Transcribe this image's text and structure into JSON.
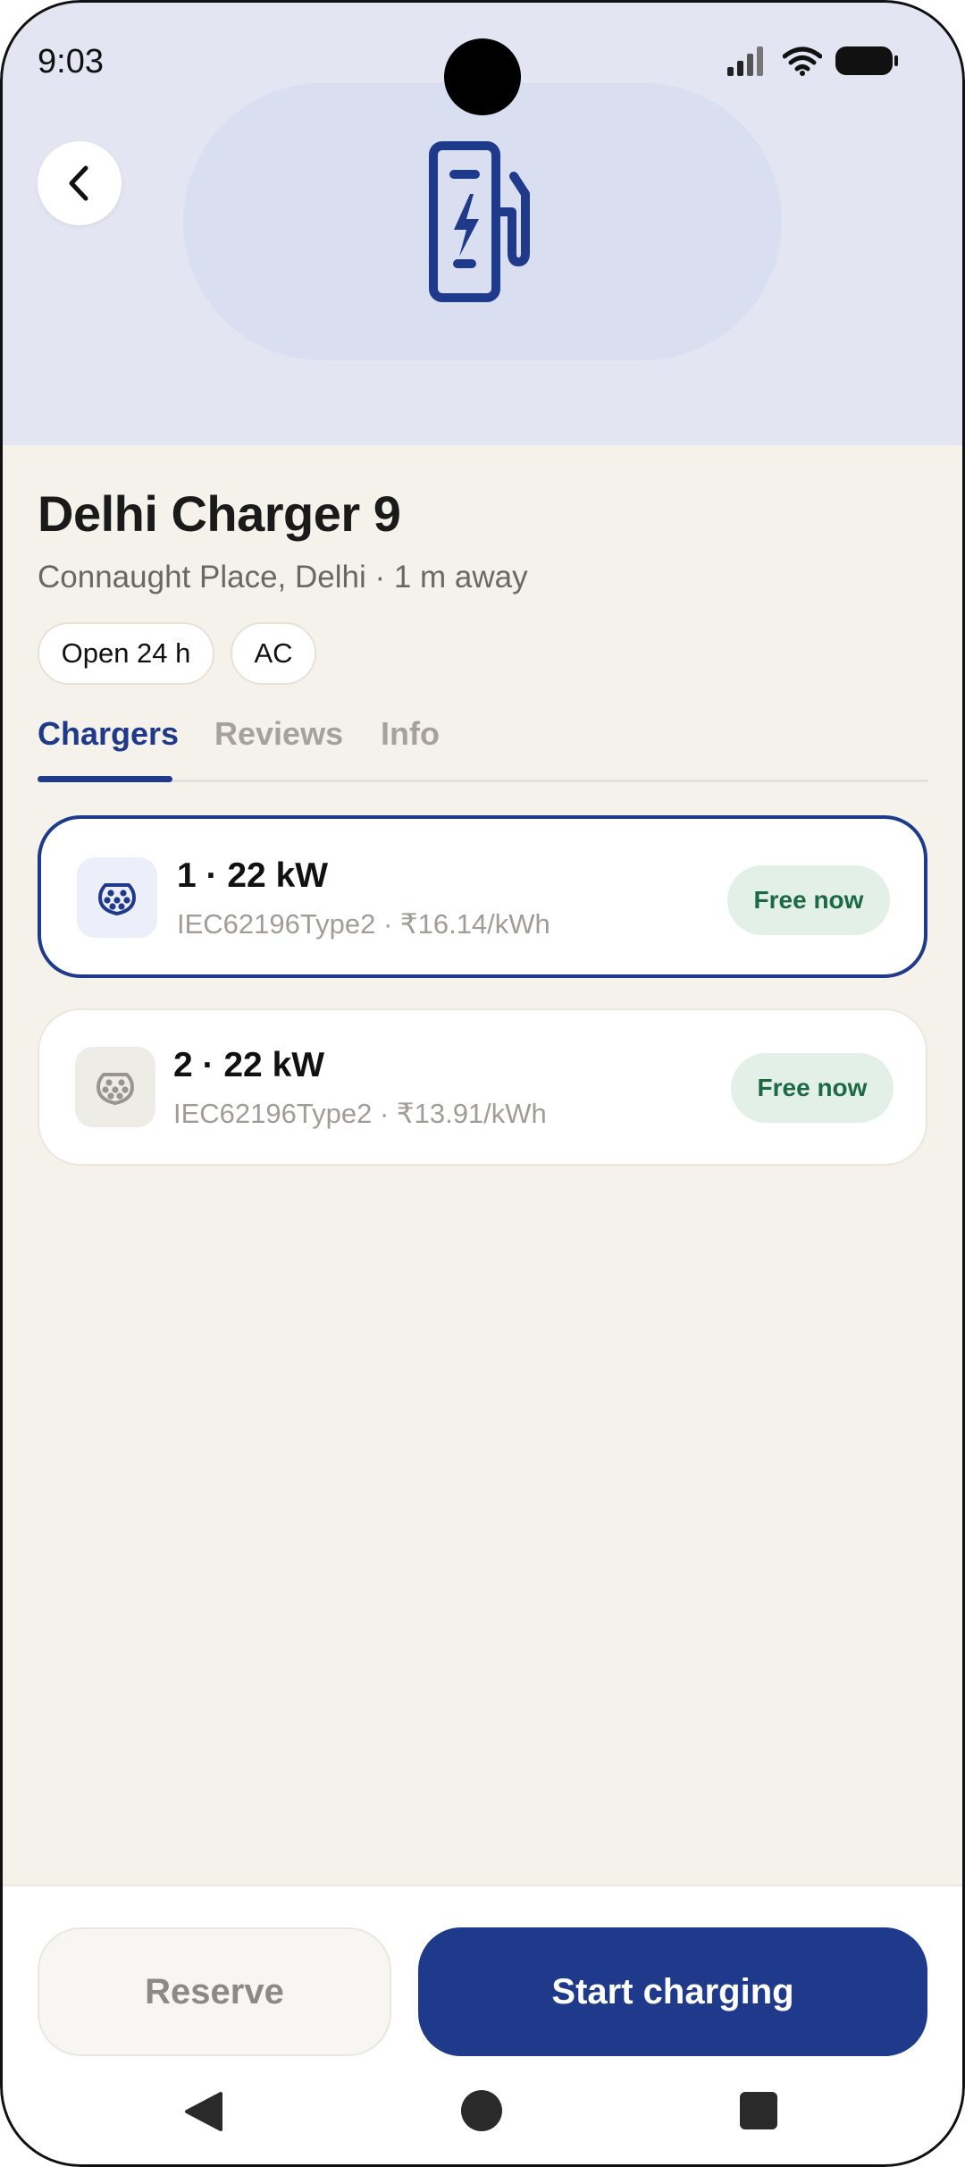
{
  "status_bar": {
    "time": "9:03",
    "icons": [
      "signal-icon",
      "wifi-icon",
      "battery-icon"
    ]
  },
  "hero": {
    "icon": "ev-charger-icon",
    "back_icon": "chevron-left-icon"
  },
  "station": {
    "name": "Delhi Charger 9",
    "location": "Connaught Place, Delhi · 1 m away",
    "chips": [
      "Open 24 h",
      "AC"
    ]
  },
  "tabs": [
    {
      "label": "Chargers",
      "active": true
    },
    {
      "label": "Reviews",
      "active": false
    },
    {
      "label": "Info",
      "active": false
    }
  ],
  "chargers": [
    {
      "name": "1 · 22 kW",
      "detail": "IEC62196Type2 · ₹16.14/kWh",
      "status": "Free now",
      "selected": true,
      "icon": "type2-connector-icon"
    },
    {
      "name": "2 · 22 kW",
      "detail": "IEC62196Type2 · ₹13.91/kWh",
      "status": "Free now",
      "selected": false,
      "icon": "type2-connector-icon"
    }
  ],
  "actions": {
    "reserve_label": "Reserve",
    "start_label": "Start charging"
  },
  "colors": {
    "accent": "#1f3a8a",
    "hero_bg": "#e3e6f2",
    "page_bg": "#f5f2ec",
    "status_free_bg": "#e3f0e8",
    "status_free_text": "#1c6a43"
  }
}
